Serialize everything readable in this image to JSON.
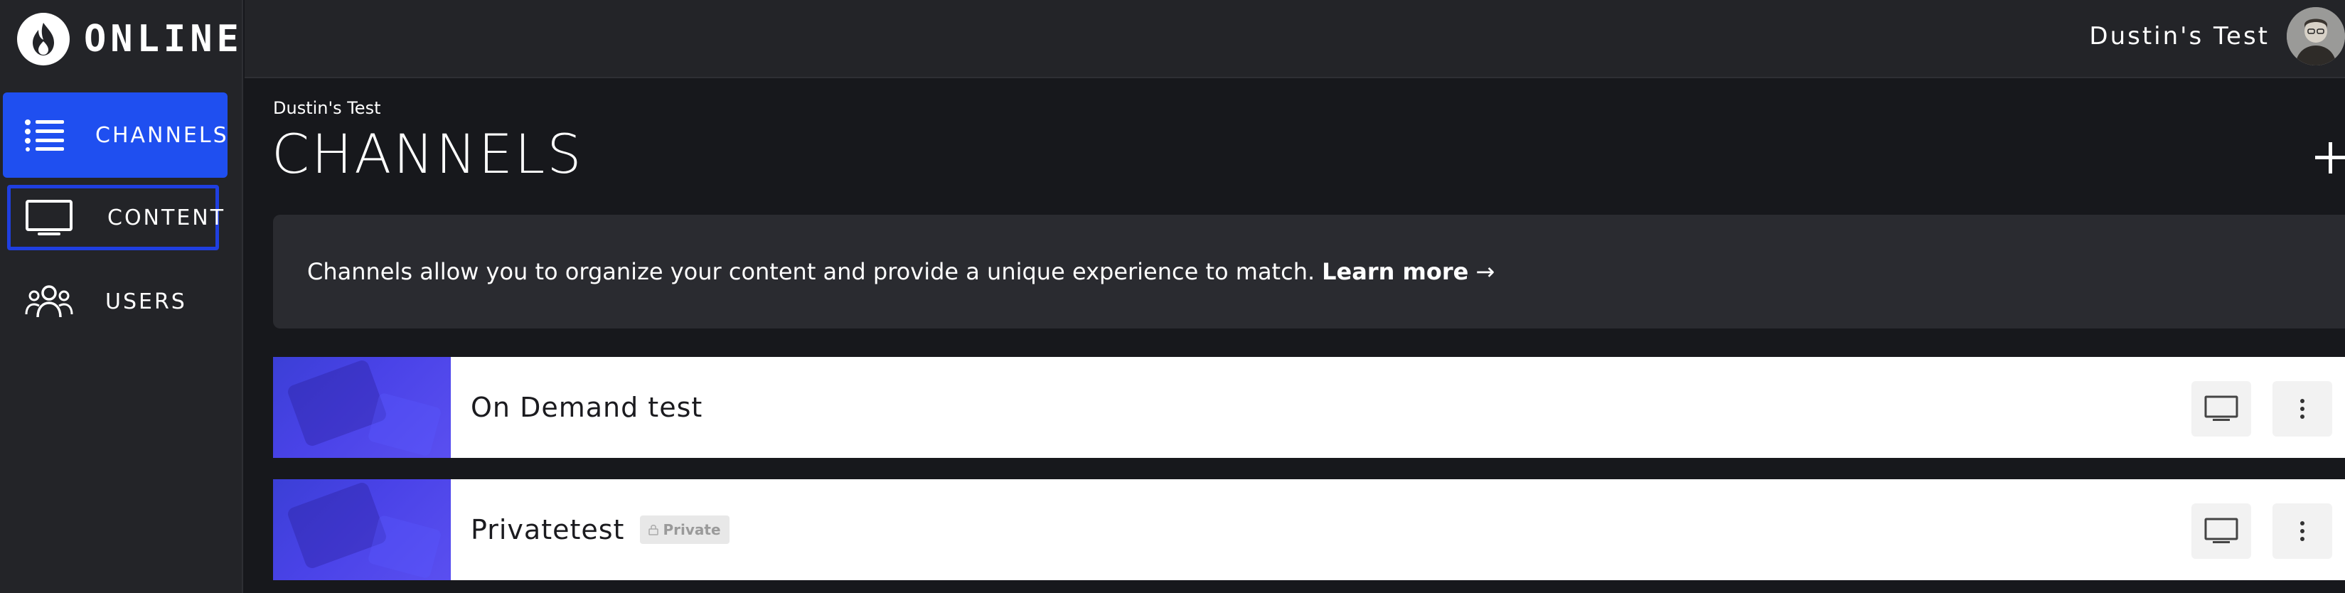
{
  "app": {
    "logo_text": "ONLINE"
  },
  "sidebar": {
    "items": [
      {
        "label": "CHANNELS",
        "icon": "list-icon",
        "active": true
      },
      {
        "label": "CONTENT",
        "icon": "monitor-icon",
        "active": false
      },
      {
        "label": "USERS",
        "icon": "users-icon",
        "active": false
      }
    ]
  },
  "header": {
    "user_name": "Dustin's Test"
  },
  "main": {
    "breadcrumb": "Dustin's Test",
    "title": "CHANNELS",
    "info_text": "Channels allow you to organize your content and provide a unique experience to match.",
    "learn_more": "Learn more",
    "arrow": "→"
  },
  "channels": [
    {
      "title": "On Demand test",
      "private": false
    },
    {
      "title": "Privatetest",
      "private": true,
      "badge": "Private"
    }
  ],
  "colors": {
    "accent": "#1f4ff0",
    "background": "#17181c",
    "sidebar": "#232428"
  }
}
